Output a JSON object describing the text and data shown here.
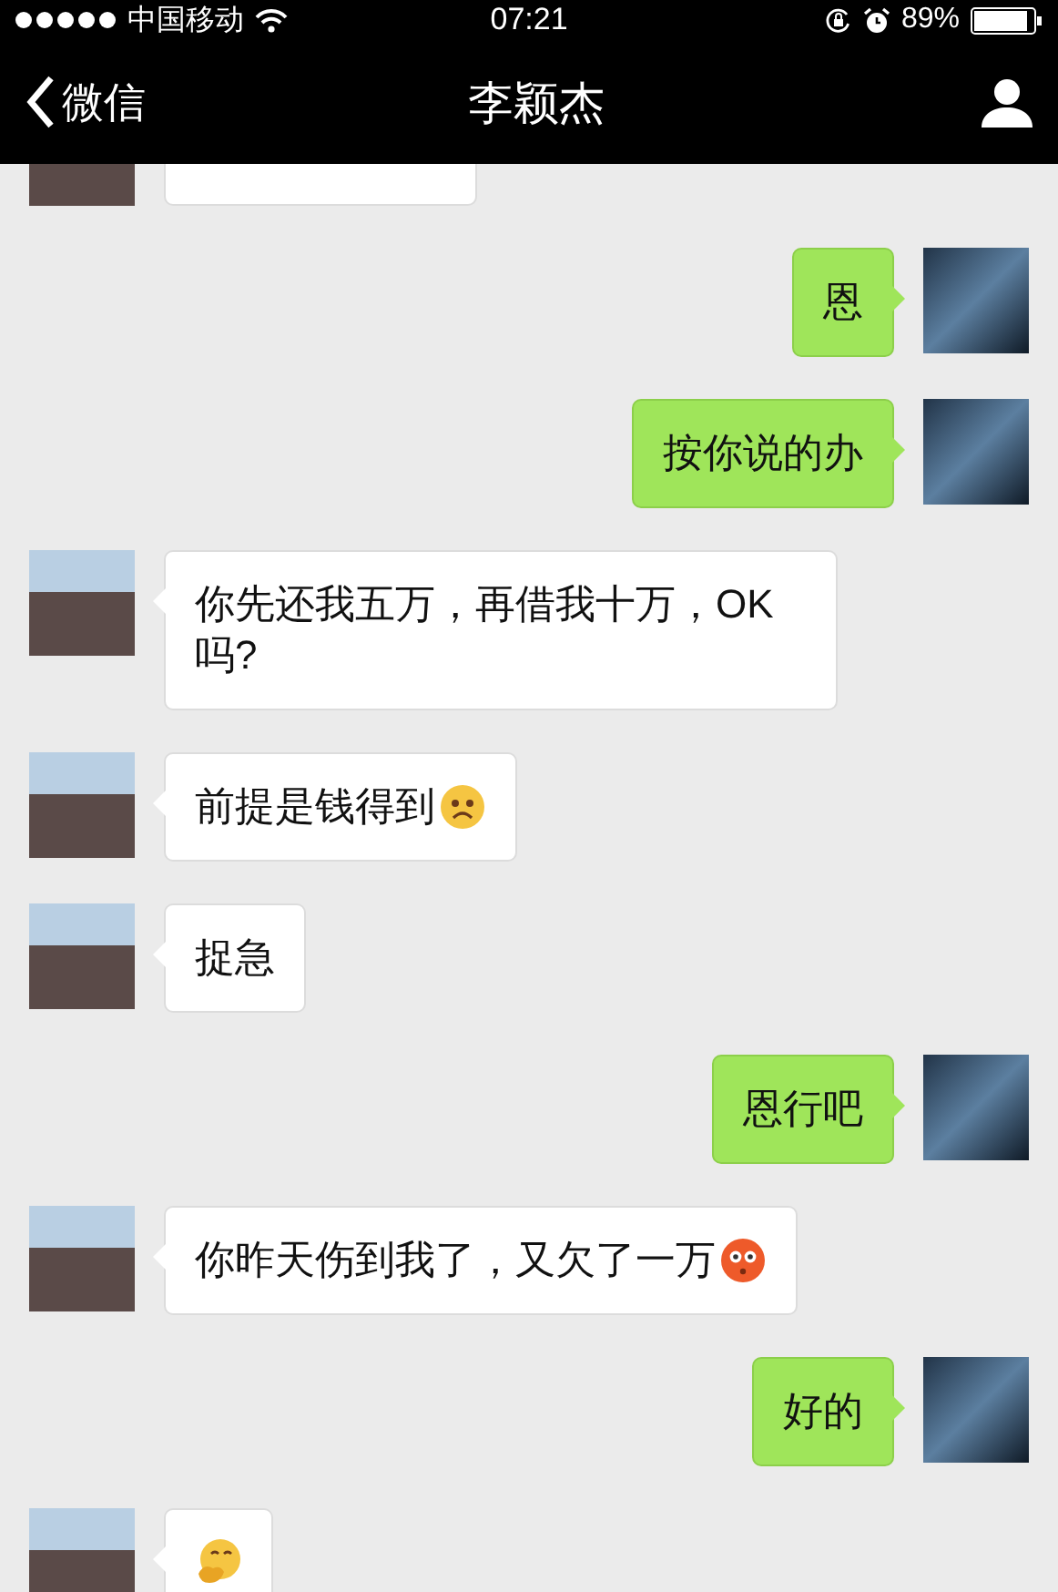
{
  "status_bar": {
    "carrier": "中国移动",
    "time": "07:21",
    "battery": "89%"
  },
  "nav": {
    "back_label": "微信",
    "title": "李颖杰"
  },
  "messages": [
    {
      "kind": "incoming",
      "partial": true
    },
    {
      "kind": "outgoing",
      "partial": false,
      "text": "恩"
    },
    {
      "kind": "outgoing",
      "partial": false,
      "text": "按你说的办"
    },
    {
      "kind": "incoming",
      "partial": false,
      "text": "你先还我五万，再借我十万，OK吗?"
    },
    {
      "kind": "incoming",
      "partial": false,
      "text": "前提是钱得到",
      "sticker": {
        "kind": "frown"
      }
    },
    {
      "kind": "incoming",
      "partial": false,
      "text": "捉急"
    },
    {
      "kind": "outgoing",
      "partial": false,
      "text": "恩行吧"
    },
    {
      "kind": "incoming",
      "partial": false,
      "text": "你昨天伤到我了，又欠了一万",
      "sticker": {
        "kind": "flushed"
      }
    },
    {
      "kind": "outgoing",
      "partial": false,
      "text": "好的"
    },
    {
      "kind": "incoming",
      "partial": false,
      "sticker": {
        "kind": "hug"
      }
    }
  ]
}
